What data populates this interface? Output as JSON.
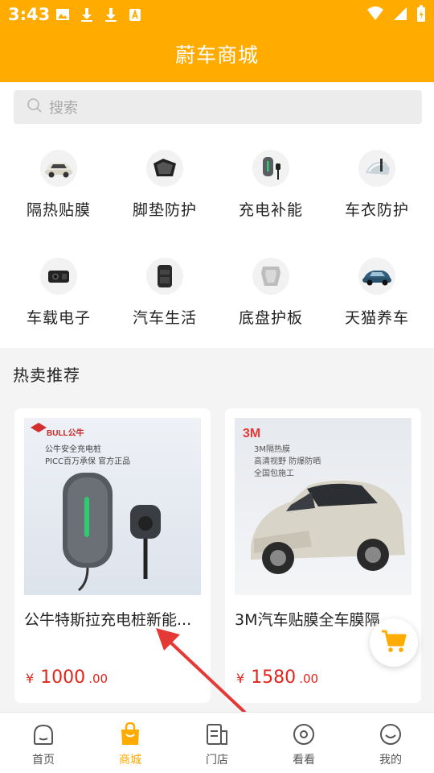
{
  "status_bar": {
    "time": "3:43"
  },
  "header": {
    "title": "蔚车商城"
  },
  "search": {
    "placeholder": "搜索"
  },
  "categories": [
    {
      "label": "隔热贴膜",
      "icon": "car-film-icon"
    },
    {
      "label": "脚垫防护",
      "icon": "floor-mat-icon"
    },
    {
      "label": "充电补能",
      "icon": "charger-icon"
    },
    {
      "label": "车衣防护",
      "icon": "car-cover-icon"
    },
    {
      "label": "车载电子",
      "icon": "dashcam-icon"
    },
    {
      "label": "汽车生活",
      "icon": "seat-organizer-icon"
    },
    {
      "label": "底盘护板",
      "icon": "skid-plate-icon"
    },
    {
      "label": "天猫养车",
      "icon": "car-service-icon"
    }
  ],
  "hot": {
    "title": "热卖推荐",
    "products": [
      {
        "name": "公牛特斯拉充电桩新能...",
        "currency": "¥",
        "price_int": "1000",
        "price_dec": ".00",
        "image_lines": [
          "公牛安全充电桩",
          "PICC百万承保 官方正品"
        ],
        "brand": "BULL公牛"
      },
      {
        "name": "3M汽车贴膜全车膜隔",
        "currency": "¥",
        "price_int": "1580",
        "price_dec": ".00",
        "image_lines": [
          "3M隔热膜",
          "高清视野 防爆防晒",
          "全国包施工"
        ],
        "brand": "3M"
      }
    ]
  },
  "tabs": [
    {
      "label": "首页",
      "icon": "home-icon"
    },
    {
      "label": "商城",
      "icon": "shopping-bag-icon"
    },
    {
      "label": "门店",
      "icon": "store-icon"
    },
    {
      "label": "看看",
      "icon": "watch-icon"
    },
    {
      "label": "我的",
      "icon": "profile-icon"
    }
  ],
  "colors": {
    "brand": "#ffab00",
    "price": "#e1251b",
    "annotation_arrow": "#e53935"
  }
}
